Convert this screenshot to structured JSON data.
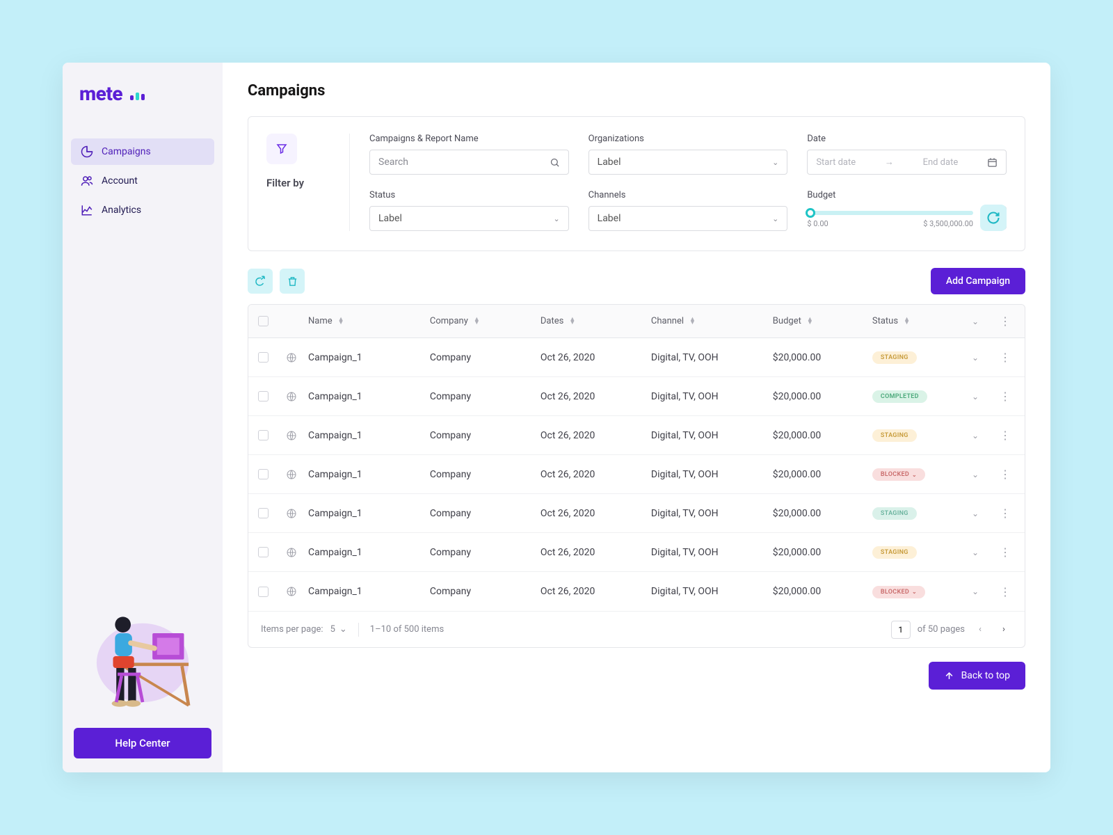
{
  "brand": "mete",
  "sidebar": {
    "items": [
      {
        "label": "Campaigns",
        "active": true
      },
      {
        "label": "Account",
        "active": false
      },
      {
        "label": "Analytics",
        "active": false
      }
    ],
    "help_label": "Help Center"
  },
  "page": {
    "title": "Campaigns",
    "filter_title": "Filter by",
    "filters": {
      "search_label": "Campaigns & Report Name",
      "search_placeholder": "Search",
      "org_label": "Organizations",
      "org_value": "Label",
      "date_label": "Date",
      "date_start_placeholder": "Start date",
      "date_end_placeholder": "End date",
      "status_label": "Status",
      "status_value": "Label",
      "channels_label": "Channels",
      "channels_value": "Label",
      "budget_label": "Budget",
      "budget_min": "$ 0.00",
      "budget_max": "$ 3,500,000.00",
      "budget_stepper_value": "0"
    },
    "add_button_label": "Add Campaign",
    "columns": {
      "name": "Name",
      "company": "Company",
      "dates": "Dates",
      "channel": "Channel",
      "budget": "Budget",
      "status": "Status"
    },
    "rows": [
      {
        "name": "Campaign_1",
        "company": "Company",
        "dates": "Oct 26, 2020",
        "channel": "Digital, TV, OOH",
        "budget": "$20,000.00",
        "status": "STAGING",
        "status_type": "staging"
      },
      {
        "name": "Campaign_1",
        "company": "Company",
        "dates": "Oct 26, 2020",
        "channel": "Digital, TV, OOH",
        "budget": "$20,000.00",
        "status": "COMPLETED",
        "status_type": "completed"
      },
      {
        "name": "Campaign_1",
        "company": "Company",
        "dates": "Oct 26, 2020",
        "channel": "Digital, TV, OOH",
        "budget": "$20,000.00",
        "status": "STAGING",
        "status_type": "staging"
      },
      {
        "name": "Campaign_1",
        "company": "Company",
        "dates": "Oct 26, 2020",
        "channel": "Digital, TV, OOH",
        "budget": "$20,000.00",
        "status": "BLOCKED",
        "status_type": "blocked",
        "has_chev": true
      },
      {
        "name": "Campaign_1",
        "company": "Company",
        "dates": "Oct 26, 2020",
        "channel": "Digital, TV, OOH",
        "budget": "$20,000.00",
        "status": "STAGING",
        "status_type": "staging2"
      },
      {
        "name": "Campaign_1",
        "company": "Company",
        "dates": "Oct 26, 2020",
        "channel": "Digital, TV, OOH",
        "budget": "$20,000.00",
        "status": "STAGING",
        "status_type": "staging"
      },
      {
        "name": "Campaign_1",
        "company": "Company",
        "dates": "Oct 26, 2020",
        "channel": "Digital, TV, OOH",
        "budget": "$20,000.00",
        "status": "BLOCKED",
        "status_type": "blocked",
        "has_chev": true
      }
    ],
    "pagination": {
      "items_per_page_label": "Items per page:",
      "items_per_page_value": "5",
      "range_text": "1–10 of 500 items",
      "current_page": "1",
      "of_pages_text": "of 50 pages"
    },
    "back_to_top_label": "Back to top"
  }
}
